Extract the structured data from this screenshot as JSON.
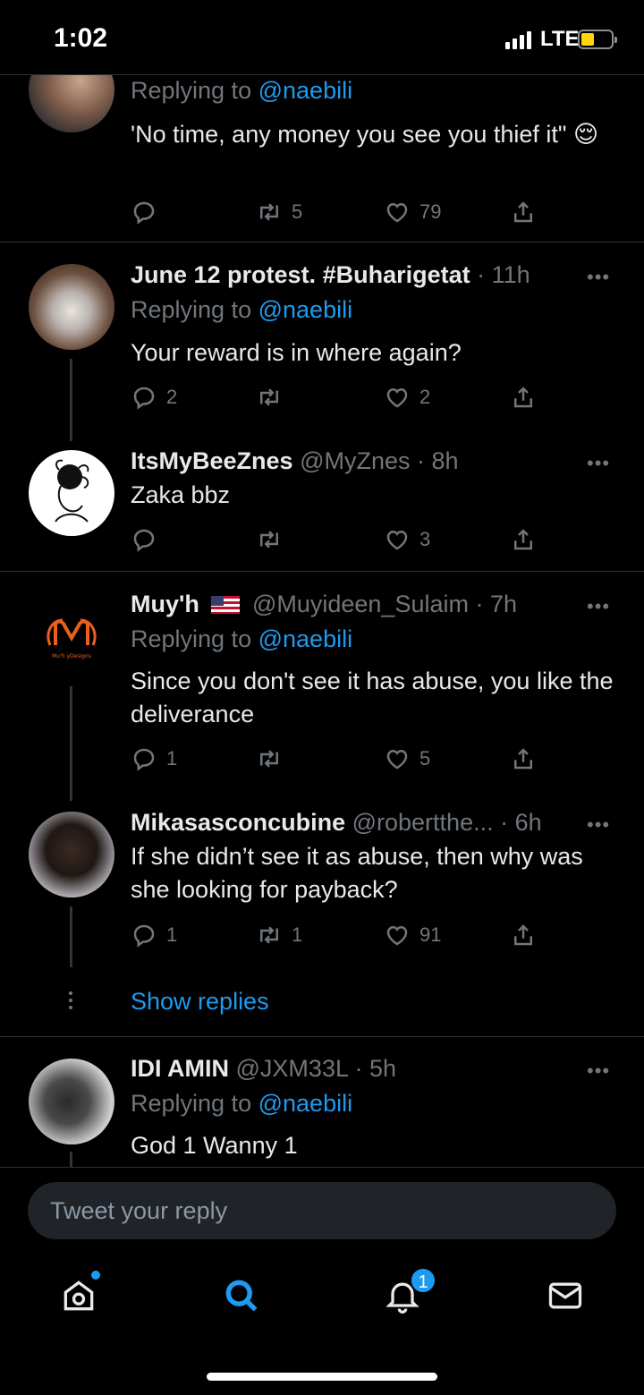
{
  "status_bar": {
    "time": "1:02",
    "network": "LTE"
  },
  "tweets": [
    {
      "replying_label": "Replying to",
      "replying_handle": "@naebili",
      "text": "'No time,  any money you see you thief it\" 😌",
      "replies": "",
      "retweets": "5",
      "likes": "79"
    },
    {
      "name": "June 12 protest. #Buharigetat",
      "handle": "",
      "time": "· 11h",
      "replying_label": "Replying to",
      "replying_handle": "@naebili",
      "text": "Your reward is in where again?",
      "replies": "2",
      "retweets": "",
      "likes": "2"
    },
    {
      "name": "ItsMyBeeZnes",
      "handle": "@MyZnes",
      "time": "· 8h",
      "text": "Zaka bbz",
      "replies": "",
      "retweets": "",
      "likes": "3"
    },
    {
      "name": "Muy'h",
      "handle": "@Muyideen_Sulaim",
      "time": "· 7h",
      "replying_label": "Replying to",
      "replying_handle": "@naebili",
      "text": "Since you don't see it has abuse, you like the deliverance",
      "replies": "1",
      "retweets": "",
      "likes": "5",
      "avatar_text": "Mu'h yDesigns"
    },
    {
      "name": "Mikasasconcubine",
      "handle": "@robertthe...",
      "time": "· 6h",
      "text": "If she didn’t see it as abuse, then why was she looking for payback?",
      "replies": "1",
      "retweets": "1",
      "likes": "91"
    },
    {
      "name": "IDI AMIN",
      "handle": "@JXM33L",
      "time": "· 5h",
      "replying_label": "Replying to",
      "replying_handle": "@naebili",
      "text": "God 1 Wanny 1"
    }
  ],
  "show_replies": "Show replies",
  "reply_box": {
    "placeholder": "Tweet your reply"
  },
  "tabbar": {
    "notifications_badge": "1"
  },
  "colors": {
    "accent": "#1d9bf0",
    "background": "#000000",
    "muted": "#71767b"
  }
}
